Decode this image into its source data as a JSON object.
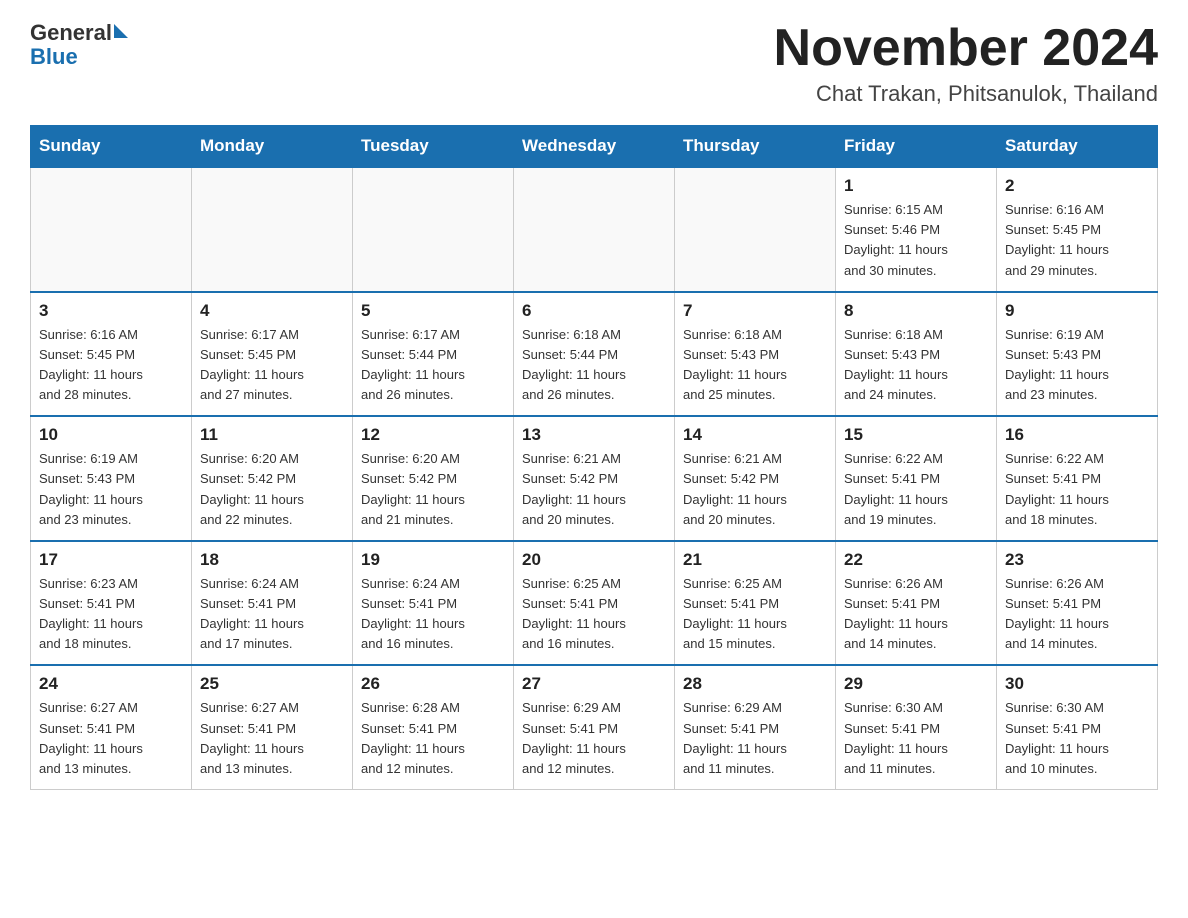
{
  "header": {
    "logo_general": "General",
    "logo_blue": "Blue",
    "month_title": "November 2024",
    "location": "Chat Trakan, Phitsanulok, Thailand"
  },
  "weekdays": [
    "Sunday",
    "Monday",
    "Tuesday",
    "Wednesday",
    "Thursday",
    "Friday",
    "Saturday"
  ],
  "weeks": [
    [
      {
        "day": "",
        "info": ""
      },
      {
        "day": "",
        "info": ""
      },
      {
        "day": "",
        "info": ""
      },
      {
        "day": "",
        "info": ""
      },
      {
        "day": "",
        "info": ""
      },
      {
        "day": "1",
        "info": "Sunrise: 6:15 AM\nSunset: 5:46 PM\nDaylight: 11 hours\nand 30 minutes."
      },
      {
        "day": "2",
        "info": "Sunrise: 6:16 AM\nSunset: 5:45 PM\nDaylight: 11 hours\nand 29 minutes."
      }
    ],
    [
      {
        "day": "3",
        "info": "Sunrise: 6:16 AM\nSunset: 5:45 PM\nDaylight: 11 hours\nand 28 minutes."
      },
      {
        "day": "4",
        "info": "Sunrise: 6:17 AM\nSunset: 5:45 PM\nDaylight: 11 hours\nand 27 minutes."
      },
      {
        "day": "5",
        "info": "Sunrise: 6:17 AM\nSunset: 5:44 PM\nDaylight: 11 hours\nand 26 minutes."
      },
      {
        "day": "6",
        "info": "Sunrise: 6:18 AM\nSunset: 5:44 PM\nDaylight: 11 hours\nand 26 minutes."
      },
      {
        "day": "7",
        "info": "Sunrise: 6:18 AM\nSunset: 5:43 PM\nDaylight: 11 hours\nand 25 minutes."
      },
      {
        "day": "8",
        "info": "Sunrise: 6:18 AM\nSunset: 5:43 PM\nDaylight: 11 hours\nand 24 minutes."
      },
      {
        "day": "9",
        "info": "Sunrise: 6:19 AM\nSunset: 5:43 PM\nDaylight: 11 hours\nand 23 minutes."
      }
    ],
    [
      {
        "day": "10",
        "info": "Sunrise: 6:19 AM\nSunset: 5:43 PM\nDaylight: 11 hours\nand 23 minutes."
      },
      {
        "day": "11",
        "info": "Sunrise: 6:20 AM\nSunset: 5:42 PM\nDaylight: 11 hours\nand 22 minutes."
      },
      {
        "day": "12",
        "info": "Sunrise: 6:20 AM\nSunset: 5:42 PM\nDaylight: 11 hours\nand 21 minutes."
      },
      {
        "day": "13",
        "info": "Sunrise: 6:21 AM\nSunset: 5:42 PM\nDaylight: 11 hours\nand 20 minutes."
      },
      {
        "day": "14",
        "info": "Sunrise: 6:21 AM\nSunset: 5:42 PM\nDaylight: 11 hours\nand 20 minutes."
      },
      {
        "day": "15",
        "info": "Sunrise: 6:22 AM\nSunset: 5:41 PM\nDaylight: 11 hours\nand 19 minutes."
      },
      {
        "day": "16",
        "info": "Sunrise: 6:22 AM\nSunset: 5:41 PM\nDaylight: 11 hours\nand 18 minutes."
      }
    ],
    [
      {
        "day": "17",
        "info": "Sunrise: 6:23 AM\nSunset: 5:41 PM\nDaylight: 11 hours\nand 18 minutes."
      },
      {
        "day": "18",
        "info": "Sunrise: 6:24 AM\nSunset: 5:41 PM\nDaylight: 11 hours\nand 17 minutes."
      },
      {
        "day": "19",
        "info": "Sunrise: 6:24 AM\nSunset: 5:41 PM\nDaylight: 11 hours\nand 16 minutes."
      },
      {
        "day": "20",
        "info": "Sunrise: 6:25 AM\nSunset: 5:41 PM\nDaylight: 11 hours\nand 16 minutes."
      },
      {
        "day": "21",
        "info": "Sunrise: 6:25 AM\nSunset: 5:41 PM\nDaylight: 11 hours\nand 15 minutes."
      },
      {
        "day": "22",
        "info": "Sunrise: 6:26 AM\nSunset: 5:41 PM\nDaylight: 11 hours\nand 14 minutes."
      },
      {
        "day": "23",
        "info": "Sunrise: 6:26 AM\nSunset: 5:41 PM\nDaylight: 11 hours\nand 14 minutes."
      }
    ],
    [
      {
        "day": "24",
        "info": "Sunrise: 6:27 AM\nSunset: 5:41 PM\nDaylight: 11 hours\nand 13 minutes."
      },
      {
        "day": "25",
        "info": "Sunrise: 6:27 AM\nSunset: 5:41 PM\nDaylight: 11 hours\nand 13 minutes."
      },
      {
        "day": "26",
        "info": "Sunrise: 6:28 AM\nSunset: 5:41 PM\nDaylight: 11 hours\nand 12 minutes."
      },
      {
        "day": "27",
        "info": "Sunrise: 6:29 AM\nSunset: 5:41 PM\nDaylight: 11 hours\nand 12 minutes."
      },
      {
        "day": "28",
        "info": "Sunrise: 6:29 AM\nSunset: 5:41 PM\nDaylight: 11 hours\nand 11 minutes."
      },
      {
        "day": "29",
        "info": "Sunrise: 6:30 AM\nSunset: 5:41 PM\nDaylight: 11 hours\nand 11 minutes."
      },
      {
        "day": "30",
        "info": "Sunrise: 6:30 AM\nSunset: 5:41 PM\nDaylight: 11 hours\nand 10 minutes."
      }
    ]
  ]
}
